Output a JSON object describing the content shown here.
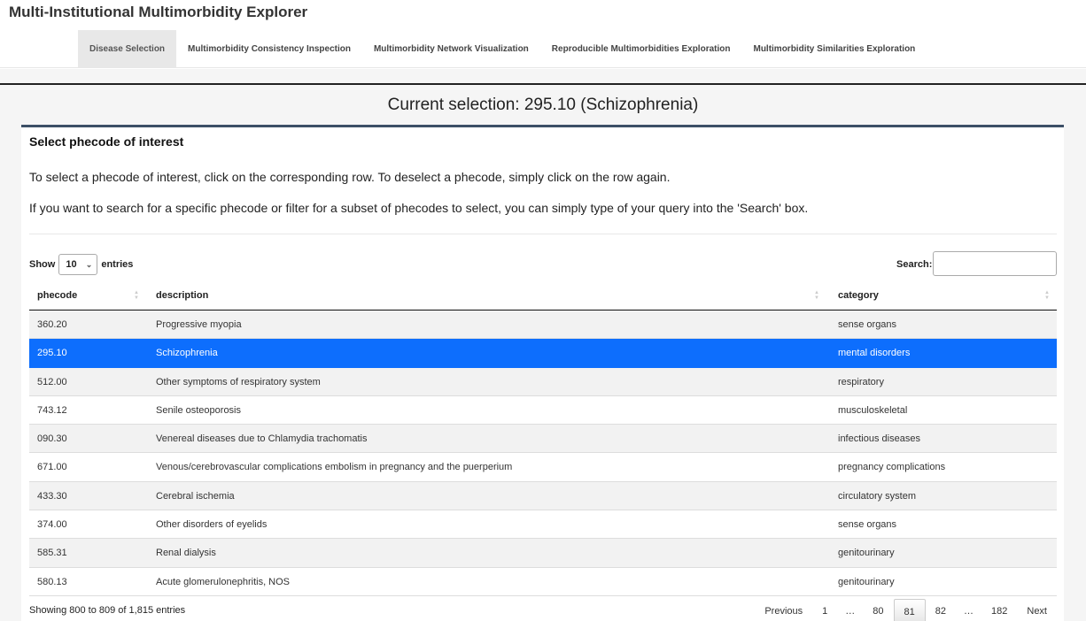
{
  "app": {
    "title": "Multi-Institutional Multimorbidity Explorer"
  },
  "nav": {
    "tabs": [
      {
        "label": "Disease Selection",
        "active": true
      },
      {
        "label": "Multimorbidity Consistency Inspection"
      },
      {
        "label": "Multimorbidity Network Visualization"
      },
      {
        "label": "Reproducible Multimorbidities Exploration"
      },
      {
        "label": "Multimorbidity Similarities Exploration"
      }
    ]
  },
  "selection": {
    "text": "Current selection: 295.10 (Schizophrenia)"
  },
  "panel": {
    "title": "Select phecode of interest",
    "instruction1": "To select a phecode of interest, click on the corresponding row. To deselect a phecode, simply click on the row again.",
    "instruction2": "If you want to search for a specific phecode or filter for a subset of phecodes to select, you can simply type of your query into the 'Search' box."
  },
  "table": {
    "show_label": "Show",
    "entries_label": "entries",
    "length_value": "10",
    "search_label": "Search:",
    "search_value": "",
    "columns": [
      "phecode",
      "description",
      "category"
    ],
    "selected_index": 1,
    "rows": [
      [
        "360.20",
        "Progressive myopia",
        "sense organs"
      ],
      [
        "295.10",
        "Schizophrenia",
        "mental disorders"
      ],
      [
        "512.00",
        "Other symptoms of respiratory system",
        "respiratory"
      ],
      [
        "743.12",
        "Senile osteoporosis",
        "musculoskeletal"
      ],
      [
        "090.30",
        "Venereal diseases due to Chlamydia trachomatis",
        "infectious diseases"
      ],
      [
        "671.00",
        "Venous/cerebrovascular complications embolism in pregnancy and the puerperium",
        "pregnancy complications"
      ],
      [
        "433.30",
        "Cerebral ischemia",
        "circulatory system"
      ],
      [
        "374.00",
        "Other disorders of eyelids",
        "sense organs"
      ],
      [
        "585.31",
        "Renal dialysis",
        "genitourinary"
      ],
      [
        "580.13",
        "Acute glomerulonephritis, NOS",
        "genitourinary"
      ]
    ],
    "info": "Showing 800 to 809 of 1,815 entries"
  },
  "pagination": {
    "previous": "Previous",
    "next": "Next",
    "ellipsis": "…",
    "pages": [
      "1",
      "80",
      "81",
      "82",
      "182"
    ],
    "current": "81"
  },
  "colors": {
    "selected_row": "#0d6efd",
    "panel_border": "#3c4f66"
  }
}
